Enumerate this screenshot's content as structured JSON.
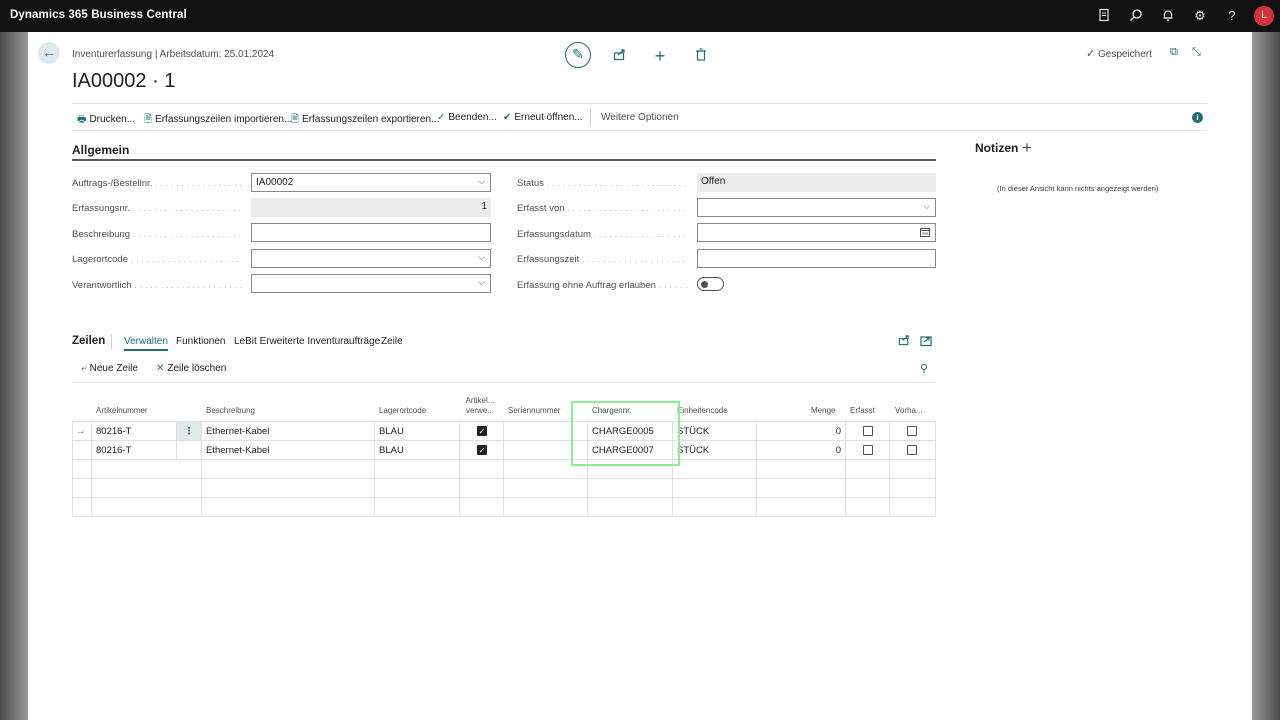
{
  "topbar": {
    "app_title": "Dynamics 365 Business Central",
    "avatar_initial": "L"
  },
  "header": {
    "breadcrumb": "Inventurerfassung | Arbeitsdatum: 25.01.2024",
    "title": "IA00002 · 1",
    "saved_status": "Gespeichert"
  },
  "actions": [
    {
      "label": "Drucken...",
      "icon": "printer-icon"
    },
    {
      "label": "Erfassungszeilen importieren...",
      "icon": "document-import-icon"
    },
    {
      "label": "Erfassungszeilen exportieren...",
      "icon": "document-export-icon"
    },
    {
      "label": "Beenden...",
      "icon": "checkmark-icon"
    },
    {
      "label": "Erneut öffnen...",
      "icon": "reopen-icon"
    },
    {
      "label": "Weitere Optionen",
      "icon": ""
    }
  ],
  "general": {
    "title": "Allgemein",
    "left": [
      {
        "label": "Auftrags-/Bestellnr.",
        "value": "IA00002",
        "dropdown": true,
        "readonly": false
      },
      {
        "label": "Erfassungsnr.",
        "value": "1",
        "dropdown": false,
        "readonly": true
      },
      {
        "label": "Beschreibung",
        "value": "",
        "dropdown": false,
        "readonly": false
      },
      {
        "label": "Lagerortcode",
        "value": "",
        "dropdown": true,
        "readonly": false
      },
      {
        "label": "Verantwortlich",
        "value": "",
        "dropdown": true,
        "readonly": false
      }
    ],
    "right": [
      {
        "label": "Status",
        "value": "Offen"
      },
      {
        "label": "Erfasst von",
        "value": ""
      },
      {
        "label": "Erfassungsdatum",
        "value": ""
      },
      {
        "label": "Erfassungszeit",
        "value": ""
      },
      {
        "label": "Erfassung ohne Auftrag erlauben",
        "value": "Aus"
      }
    ]
  },
  "notes": {
    "title": "Notizen",
    "empty_text": "(In dieser Ansicht kann nichts angezeigt werden)"
  },
  "lines": {
    "title": "Zeilen",
    "tabs": [
      "Verwalten",
      "Funktionen",
      "LeBit Erweiterte Inventuraufträge",
      "Zeile"
    ],
    "new_line": "Neue Zeile",
    "delete_line": "Zeile löschen",
    "columns": [
      "Artikelnummer",
      "Beschreibung",
      "Lagerortcode",
      "Artikel... verwe...",
      "Seriennummer",
      "Chargennr.",
      "Einheitencode",
      "Menge",
      "Erfasst",
      "Vorha..."
    ],
    "rows": [
      {
        "item": "80216-T",
        "description": "Ethernet-Kabel",
        "location": "BLAU",
        "item_used": true,
        "serial": "",
        "lot": "CHARGE0005",
        "unit": "STÜCK",
        "qty": "0",
        "recorded": false,
        "present": false
      },
      {
        "item": "80216-T",
        "description": "Ethernet-Kabel",
        "location": "BLAU",
        "item_used": true,
        "serial": "",
        "lot": "CHARGE0007",
        "unit": "STÜCK",
        "qty": "0",
        "recorded": false,
        "present": false
      }
    ]
  }
}
